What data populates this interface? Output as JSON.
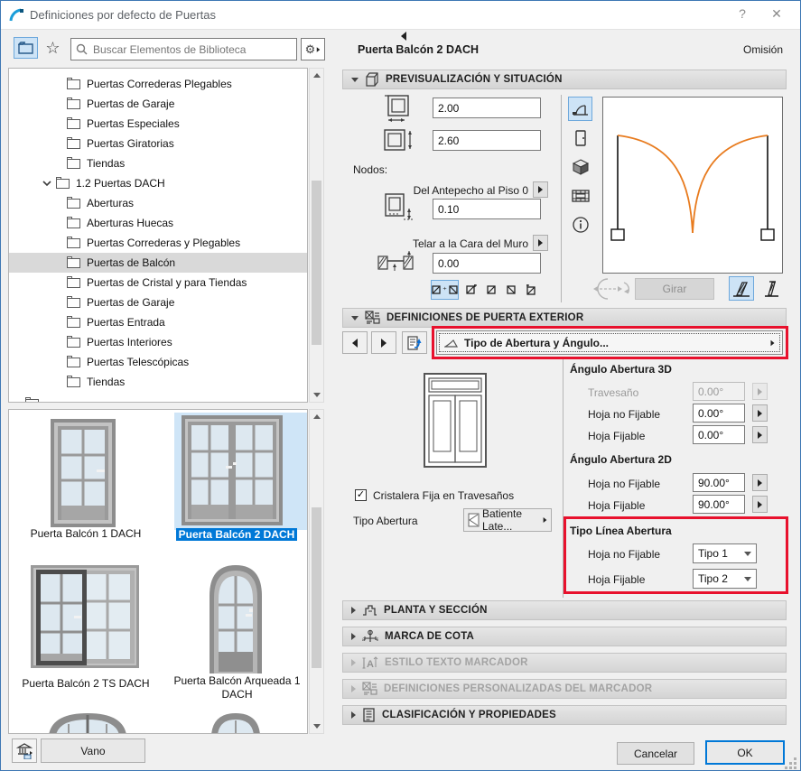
{
  "window": {
    "title": "Definiciones por defecto de Puertas",
    "help_label": "?",
    "close_label": "✕"
  },
  "toolbar": {
    "search_placeholder": "Buscar Elementos de Biblioteca"
  },
  "tree": {
    "items": [
      {
        "label": "Puertas Correderas Plegables",
        "level": 2,
        "selected": false
      },
      {
        "label": "Puertas de Garaje",
        "level": 2,
        "selected": false
      },
      {
        "label": "Puertas Especiales",
        "level": 2,
        "selected": false
      },
      {
        "label": "Puertas Giratorias",
        "level": 2,
        "selected": false
      },
      {
        "label": "Tiendas",
        "level": 2,
        "selected": false
      },
      {
        "label": "1.2 Puertas DACH",
        "level": 1,
        "expanded": true,
        "selected": false
      },
      {
        "label": "Aberturas",
        "level": 2,
        "selected": false
      },
      {
        "label": "Aberturas Huecas",
        "level": 2,
        "selected": false
      },
      {
        "label": "Puertas Correderas y Plegables",
        "level": 2,
        "selected": false
      },
      {
        "label": "Puertas de Balcón",
        "level": 2,
        "selected": true
      },
      {
        "label": "Puertas de Cristal y para Tiendas",
        "level": 2,
        "selected": false
      },
      {
        "label": "Puertas de Garaje",
        "level": 2,
        "selected": false
      },
      {
        "label": "Puertas Entrada",
        "level": 2,
        "selected": false
      },
      {
        "label": "Puertas Interiores",
        "level": 2,
        "selected": false
      },
      {
        "label": "Puertas Telescópicas",
        "level": 2,
        "selected": false
      },
      {
        "label": "Tiendas",
        "level": 2,
        "selected": false
      }
    ]
  },
  "thumbnails": {
    "items": [
      {
        "label": "Puerta Balcón 1 DACH",
        "selected": false
      },
      {
        "label": "Puerta Balcón 2 DACH",
        "selected": true
      },
      {
        "label": "Puerta Balcón 2 TS DACH",
        "selected": false
      },
      {
        "label": "Puerta Balcón Arqueada 1 DACH",
        "selected": false
      }
    ]
  },
  "footer_left": {
    "vano_label": "Vano"
  },
  "panel": {
    "item_name": "Puerta Balcón 2 DACH",
    "omission_label": "Omisión",
    "preview": {
      "section_title": "PREVISUALIZACIÓN Y SITUACIÓN",
      "width_value": "2.00",
      "height_value": "2.60",
      "nodos_label": "Nodos:",
      "sill_label": "Del Antepecho al Piso 0",
      "sill_value": "0.10",
      "reveal_label": "Telar a la Cara del Muro",
      "reveal_value": "0.00",
      "girar_label": "Girar"
    },
    "exterior": {
      "section_title": "DEFINICIONES DE PUERTA EXTERIOR",
      "opening_type_button": "Tipo de Abertura y Ángulo...",
      "checkbox_label": "Cristalera Fija en Travesaños",
      "tipo_abertura_label": "Tipo Abertura",
      "tipo_abertura_value": "Batiente Late...",
      "angulo_3d_title": "Ángulo Abertura 3D",
      "angulo_3d": [
        {
          "label": "Travesaño",
          "value": "0.00°",
          "disabled": true
        },
        {
          "label": "Hoja no Fijable",
          "value": "0.00°",
          "disabled": false
        },
        {
          "label": "Hoja Fijable",
          "value": "0.00°",
          "disabled": false
        }
      ],
      "angulo_2d_title": "Ángulo Abertura 2D",
      "angulo_2d": [
        {
          "label": "Hoja no Fijable",
          "value": "90.00°"
        },
        {
          "label": "Hoja Fijable",
          "value": "90.00°"
        }
      ],
      "tipo_linea_title": "Tipo Línea Abertura",
      "tipo_linea": [
        {
          "label": "Hoja no Fijable",
          "value": "Tipo 1"
        },
        {
          "label": "Hoja Fijable",
          "value": "Tipo 2"
        }
      ]
    },
    "sections": [
      {
        "label": "PLANTA Y SECCIÓN",
        "disabled": false
      },
      {
        "label": "MARCA DE COTA",
        "disabled": false
      },
      {
        "label": "ESTILO TEXTO MARCADOR",
        "disabled": true
      },
      {
        "label": "DEFINICIONES PERSONALIZADAS DEL MARCADOR",
        "disabled": true
      },
      {
        "label": "CLASIFICACIÓN Y PROPIEDADES",
        "disabled": false
      }
    ],
    "buttons": {
      "cancel": "Cancelar",
      "ok": "OK"
    }
  },
  "colors": {
    "accent_blue": "#0078d7",
    "selection_blue_bg": "#cde3f6",
    "tree_selection_gray": "#d9d9d9",
    "annotation_red": "#e8112d",
    "door_arc_orange": "#e87b1e"
  }
}
